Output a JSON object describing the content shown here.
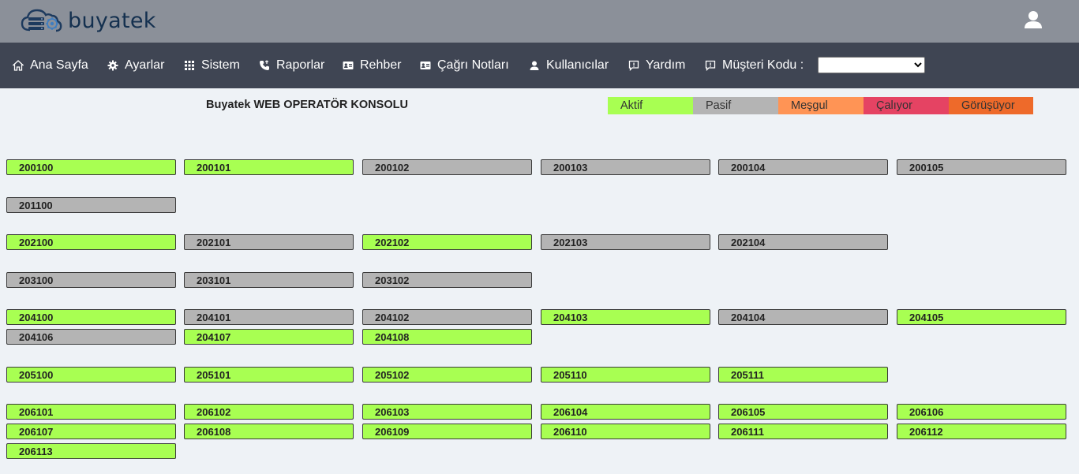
{
  "brand": {
    "name": "buyatek"
  },
  "nav": {
    "items": [
      {
        "label": "Ana Sayfa",
        "icon": "home-icon"
      },
      {
        "label": "Ayarlar",
        "icon": "gear-icon"
      },
      {
        "label": "Sistem",
        "icon": "grid-icon"
      },
      {
        "label": "Raporlar",
        "icon": "phone-icon"
      },
      {
        "label": "Rehber",
        "icon": "contact-card-icon"
      },
      {
        "label": "Çağrı Notları",
        "icon": "notes-card-icon"
      },
      {
        "label": "Kullanıcılar",
        "icon": "user-icon"
      },
      {
        "label": "Yardım",
        "icon": "help-bubble-icon"
      },
      {
        "label": "Müşteri Kodu :",
        "icon": "help-bubble-icon"
      }
    ],
    "customer_code_value": ""
  },
  "console": {
    "title": "Buyatek WEB OPERATÖR KONSOLU"
  },
  "legend": [
    {
      "label": "Aktif",
      "color": "#a8ff52"
    },
    {
      "label": "Pasif",
      "color": "#b4b4b4"
    },
    {
      "label": "Meşgul",
      "color": "#ff9455"
    },
    {
      "label": "Çalıyor",
      "color": "#e54363"
    },
    {
      "label": "Görüşüyor",
      "color": "#ee6a2a"
    }
  ],
  "colors": {
    "active": "#a8ff52",
    "passive": "#b4b4b4",
    "topbar": "#8b9099",
    "navbar": "#3f4553"
  },
  "groups": [
    {
      "rows": [
        [
          {
            "ext": "200100",
            "status": "active"
          },
          {
            "ext": "200101",
            "status": "active"
          },
          {
            "ext": "200102",
            "status": "passive"
          },
          {
            "ext": "200103",
            "status": "passive"
          },
          {
            "ext": "200104",
            "status": "passive"
          },
          {
            "ext": "200105",
            "status": "passive"
          }
        ]
      ]
    },
    {
      "rows": [
        [
          {
            "ext": "201100",
            "status": "passive"
          }
        ]
      ]
    },
    {
      "rows": [
        [
          {
            "ext": "202100",
            "status": "active"
          },
          {
            "ext": "202101",
            "status": "passive"
          },
          {
            "ext": "202102",
            "status": "active"
          },
          {
            "ext": "202103",
            "status": "passive"
          },
          {
            "ext": "202104",
            "status": "passive"
          }
        ]
      ]
    },
    {
      "rows": [
        [
          {
            "ext": "203100",
            "status": "passive"
          },
          {
            "ext": "203101",
            "status": "passive"
          },
          {
            "ext": "203102",
            "status": "passive"
          }
        ]
      ]
    },
    {
      "rows": [
        [
          {
            "ext": "204100",
            "status": "active"
          },
          {
            "ext": "204101",
            "status": "passive"
          },
          {
            "ext": "204102",
            "status": "passive"
          },
          {
            "ext": "204103",
            "status": "active"
          },
          {
            "ext": "204104",
            "status": "passive"
          },
          {
            "ext": "204105",
            "status": "active"
          }
        ],
        [
          {
            "ext": "204106",
            "status": "passive"
          },
          {
            "ext": "204107",
            "status": "active"
          },
          {
            "ext": "204108",
            "status": "active"
          }
        ]
      ]
    },
    {
      "rows": [
        [
          {
            "ext": "205100",
            "status": "active"
          },
          {
            "ext": "205101",
            "status": "active"
          },
          {
            "ext": "205102",
            "status": "active"
          },
          {
            "ext": "205110",
            "status": "active"
          },
          {
            "ext": "205111",
            "status": "active"
          }
        ]
      ]
    },
    {
      "rows": [
        [
          {
            "ext": "206101",
            "status": "active"
          },
          {
            "ext": "206102",
            "status": "active"
          },
          {
            "ext": "206103",
            "status": "active"
          },
          {
            "ext": "206104",
            "status": "active"
          },
          {
            "ext": "206105",
            "status": "active"
          },
          {
            "ext": "206106",
            "status": "active"
          }
        ],
        [
          {
            "ext": "206107",
            "status": "active"
          },
          {
            "ext": "206108",
            "status": "active"
          },
          {
            "ext": "206109",
            "status": "active"
          },
          {
            "ext": "206110",
            "status": "active"
          },
          {
            "ext": "206111",
            "status": "active"
          },
          {
            "ext": "206112",
            "status": "active"
          }
        ],
        [
          {
            "ext": "206113",
            "status": "active"
          }
        ]
      ]
    }
  ]
}
